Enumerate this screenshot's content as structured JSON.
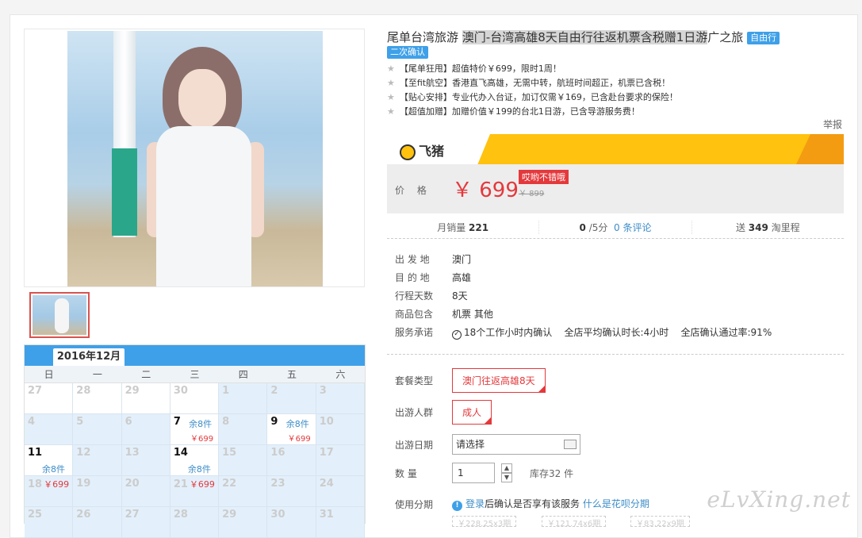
{
  "title": {
    "part1": "尾单台湾旅游 ",
    "highlight": "澳门-台湾高雄8天自由行往返机票含税赠1日游",
    "part2": "广之旅",
    "tag1": "自由行",
    "tag2": "二次确认"
  },
  "points": [
    "【尾单狂甩】超值特价￥699，限时1周！",
    "【至fit航空】香港直飞高雄，无需中转，航班时间超正，机票已含税！",
    "【贴心安排】专业代办入台证，加订仅需￥169，已含赴台要求的保险！",
    "【超值加赠】加赠价值￥199的台北1日游，已含导游服务费！"
  ],
  "report": "举报",
  "brand": "飞猪",
  "price": {
    "label": "价 格",
    "value": "￥ 699",
    "promo": "哎哟不错哦",
    "old": "￥ 899"
  },
  "stats": {
    "sales_label": "月销量",
    "sales": "221",
    "rating": "0",
    "rating_suffix": "/5分",
    "reviews": "0 条评论",
    "mileage_prefix": "送",
    "mileage": "349",
    "mileage_suffix": "淘里程"
  },
  "info": [
    {
      "k": "出 发 地",
      "v": "澳门"
    },
    {
      "k": "目 的 地",
      "v": "高雄"
    },
    {
      "k": "行程天数",
      "v": "8天"
    },
    {
      "k": "商品包含",
      "v": "机票  其他"
    }
  ],
  "service": {
    "k": "服务承诺",
    "v1": "18个工作小时内确认",
    "v2": "全店平均确认时长:4小时",
    "v3": "全店确认通过率:91%"
  },
  "options": {
    "package_label": "套餐类型",
    "package": "澳门往返高雄8天",
    "people_label": "出游人群",
    "people": "成人",
    "date_label": "出游日期",
    "date_value": "请选择",
    "qty_label": "数  量",
    "qty": "1",
    "stock": "库存32 件",
    "installment_label": "使用分期",
    "installment_link1": "登录",
    "installment_text": "后确认是否享有该服务",
    "installment_link2": "什么是花呗分期",
    "stubs": [
      "￥228.25x3期",
      "￥121.74x6期",
      "￥83.22x9期"
    ]
  },
  "calendar": {
    "month": "2016年12月",
    "weekdays": [
      "日",
      "一",
      "二",
      "三",
      "四",
      "五",
      "六"
    ]
  },
  "watermark": "eLvXing.net"
}
